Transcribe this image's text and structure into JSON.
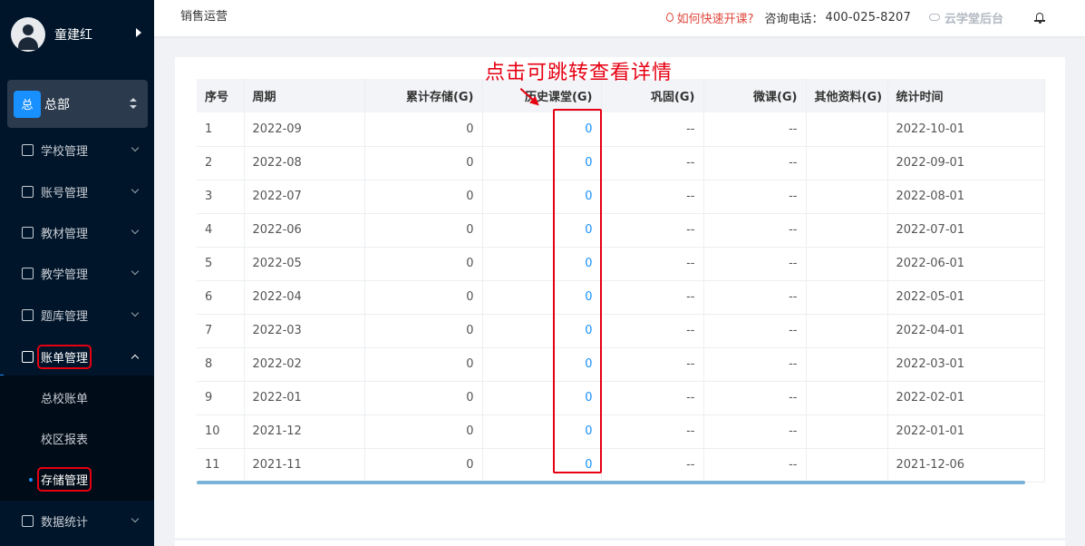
{
  "user": {
    "name": "童建红"
  },
  "org": {
    "badge": "总",
    "label": "总部"
  },
  "menu": [
    {
      "label": "学校管理",
      "icon": "school-icon"
    },
    {
      "label": "账号管理",
      "icon": "account-icon"
    },
    {
      "label": "教材管理",
      "icon": "book-icon"
    },
    {
      "label": "教学管理",
      "icon": "teaching-icon"
    },
    {
      "label": "题库管理",
      "icon": "question-bank-icon"
    },
    {
      "label": "账单管理",
      "icon": "bill-icon"
    },
    {
      "label": "数据统计",
      "icon": "chart-icon"
    }
  ],
  "submenu": [
    {
      "label": "总校账单"
    },
    {
      "label": "校区报表"
    },
    {
      "label": "存储管理"
    }
  ],
  "header": {
    "breadcrumb": "销售运营",
    "howto": "如何快速开课?",
    "phone_label": "咨询电话：",
    "phone_number": "400-025-8207",
    "brand": "云学堂后台"
  },
  "annotation": "点击可跳转查看详情",
  "table": {
    "columns": [
      "序号",
      "周期",
      "累计存储(G)",
      "历史课堂(G)",
      "巩固(G)",
      "微课(G)",
      "其他资料(G)",
      "统计时间"
    ],
    "rows": [
      [
        "1",
        "2022-09",
        "0",
        "0",
        "--",
        "--",
        "",
        "2022-10-01"
      ],
      [
        "2",
        "2022-08",
        "0",
        "0",
        "--",
        "--",
        "",
        "2022-09-01"
      ],
      [
        "3",
        "2022-07",
        "0",
        "0",
        "--",
        "--",
        "",
        "2022-08-01"
      ],
      [
        "4",
        "2022-06",
        "0",
        "0",
        "--",
        "--",
        "",
        "2022-07-01"
      ],
      [
        "5",
        "2022-05",
        "0",
        "0",
        "--",
        "--",
        "",
        "2022-06-01"
      ],
      [
        "6",
        "2022-04",
        "0",
        "0",
        "--",
        "--",
        "",
        "2022-05-01"
      ],
      [
        "7",
        "2022-03",
        "0",
        "0",
        "--",
        "--",
        "",
        "2022-04-01"
      ],
      [
        "8",
        "2022-02",
        "0",
        "0",
        "--",
        "--",
        "",
        "2022-03-01"
      ],
      [
        "9",
        "2022-01",
        "0",
        "0",
        "--",
        "--",
        "",
        "2022-02-01"
      ],
      [
        "10",
        "2021-12",
        "0",
        "0",
        "--",
        "--",
        "",
        "2022-01-01"
      ],
      [
        "11",
        "2021-11",
        "0",
        "0",
        "--",
        "--",
        "",
        "2021-12-06"
      ]
    ]
  },
  "colors": {
    "sidebar": "#001529",
    "accent": "#1890ff",
    "annotation": "#e60012"
  }
}
